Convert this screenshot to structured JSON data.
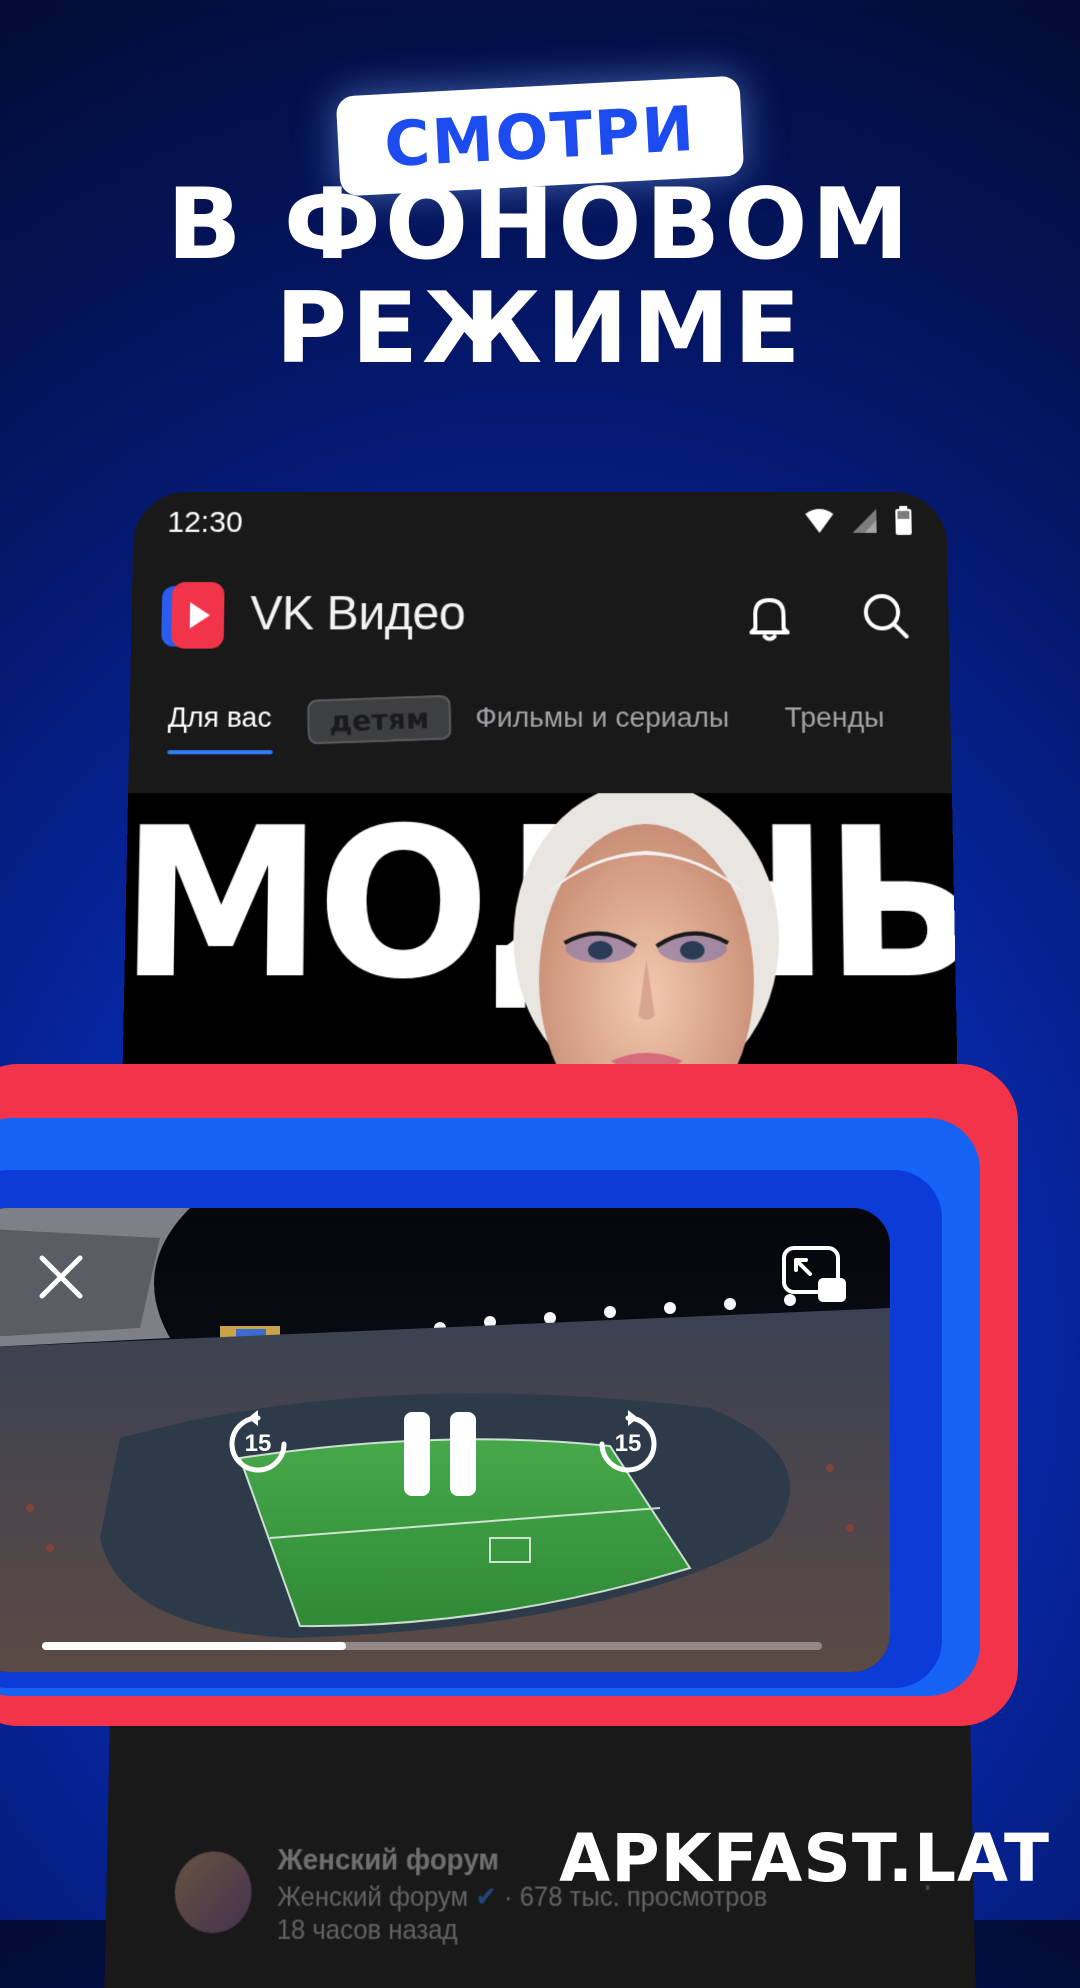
{
  "headline": {
    "pill_text": "СМОТРИ",
    "line1": "В ФОНОВОМ",
    "line2": "РЕЖИМЕ"
  },
  "status_bar": {
    "time": "12:30"
  },
  "app_bar": {
    "title": "VK Видео"
  },
  "tabs": [
    {
      "label": "Для вас",
      "active": true
    },
    {
      "label": "детям",
      "active": false
    },
    {
      "label": "Фильмы и сериалы",
      "active": false
    },
    {
      "label": "Тренды",
      "active": false
    }
  ],
  "banner": {
    "text": "МОДНЫЙ"
  },
  "feed_item": {
    "title": "Женский форум",
    "channel": "Женский форум",
    "views": "· 678 тыс. просмотров",
    "age": "18 часов назад"
  },
  "player": {
    "rewind_seconds": "15",
    "forward_seconds": "15",
    "progress": 0.39
  },
  "watermark": "APKFAST.LAT",
  "colors": {
    "accent_blue": "#1662f5",
    "accent_red": "#f2344a",
    "pill_text": "#1c4bf0"
  }
}
